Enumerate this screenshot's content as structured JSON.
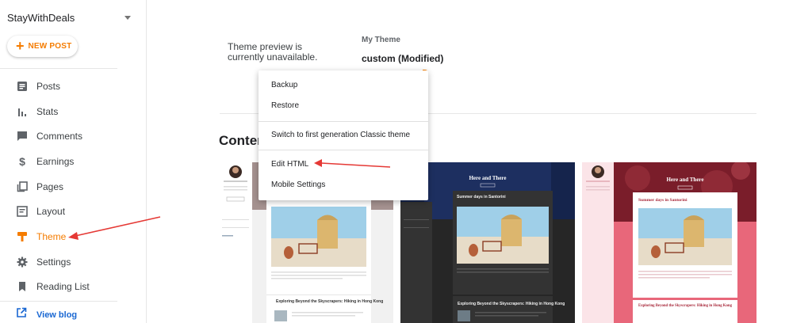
{
  "sidebar": {
    "blog_name": "StayWithDeals",
    "new_post_label": "NEW POST",
    "items": [
      {
        "label": "Posts",
        "icon": "posts-icon"
      },
      {
        "label": "Stats",
        "icon": "stats-icon"
      },
      {
        "label": "Comments",
        "icon": "comments-icon"
      },
      {
        "label": "Earnings",
        "icon": "dollar-icon"
      },
      {
        "label": "Pages",
        "icon": "pages-icon"
      },
      {
        "label": "Layout",
        "icon": "layout-icon"
      },
      {
        "label": "Theme",
        "icon": "theme-icon",
        "active": true
      },
      {
        "label": "Settings",
        "icon": "gear-icon"
      },
      {
        "label": "Reading List",
        "icon": "bookmark-icon"
      }
    ],
    "view_blog_label": "View blog"
  },
  "main": {
    "preview_message": "Theme preview is currently unavailable.",
    "my_theme_label": "My Theme",
    "my_theme_name": "custom (Modified)",
    "section_title": "Conten"
  },
  "menu": {
    "items": [
      "Backup",
      "Restore",
      "Switch to first generation Classic theme",
      "Edit HTML",
      "Mobile Settings"
    ]
  },
  "thumbnails": [
    {
      "blog_title": "",
      "post1_title": "",
      "post2_title": "Exploring Beyond the Skyscrapers: Hiking in Hong Kong"
    },
    {
      "blog_title": "Here and There",
      "post1_title": "Summer days in Santorini",
      "post2_title": "Exploring Beyond the Skyscrapers: Hiking in Hong Kong"
    },
    {
      "blog_title": "Here and There",
      "post1_title": "Summer days in Santorini",
      "post2_title": "Exploring Beyond the Skyscrapers: Hiking in Hong Kong"
    }
  ],
  "colors": {
    "accent": "#f57c00",
    "link": "#1967d2",
    "annotation_arrow": "#e53935"
  }
}
